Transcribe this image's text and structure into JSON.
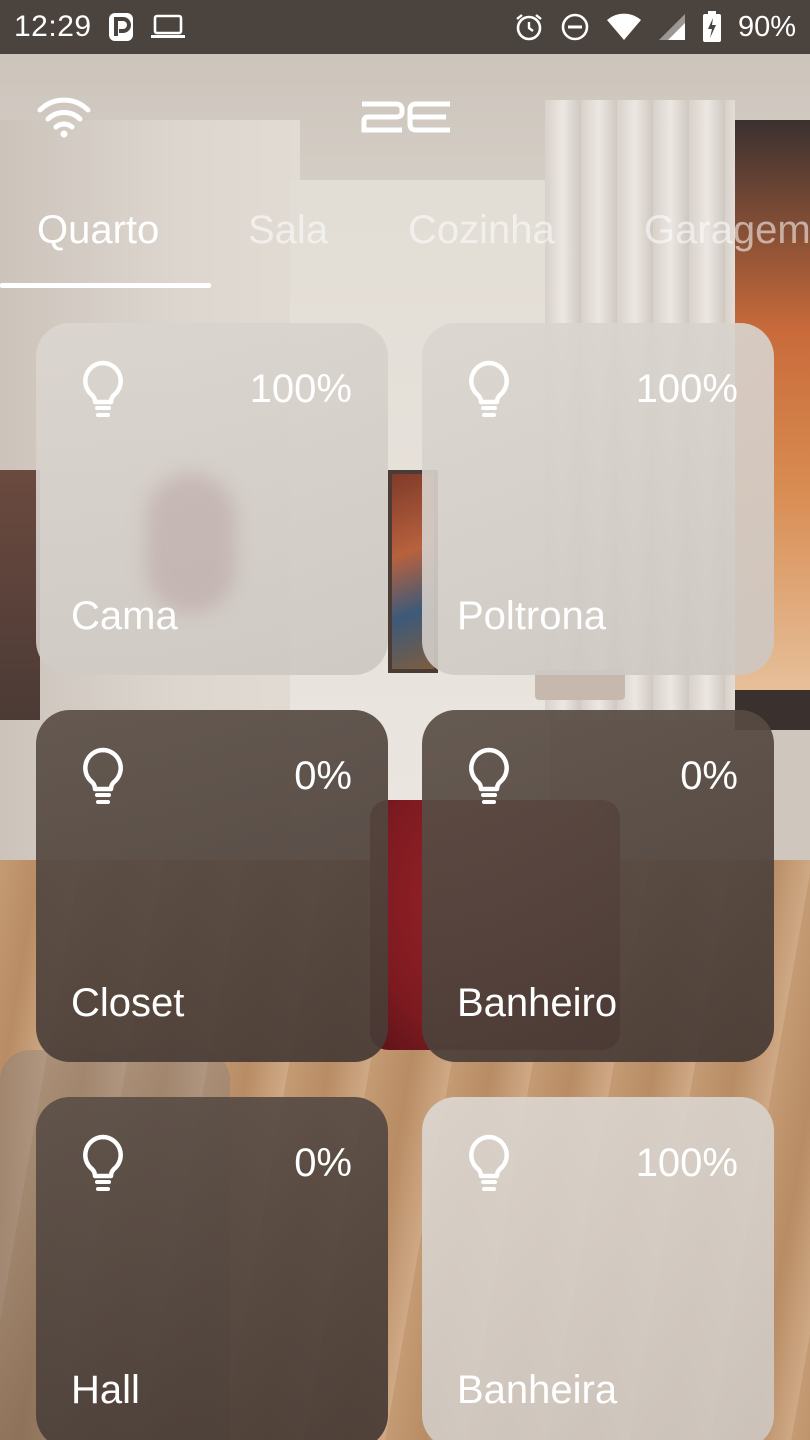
{
  "status_bar": {
    "time": "12:29",
    "left_icons": [
      "parking-app-icon",
      "laptop-icon"
    ],
    "right_icons": [
      "alarm-icon",
      "do-not-disturb-icon",
      "wifi-signal-icon",
      "cell-signal-icon",
      "battery-charging-icon"
    ],
    "battery": "90%"
  },
  "header": {
    "wifi_icon": "wifi-icon",
    "logo_text": "2E"
  },
  "tabs": [
    {
      "label": "Quarto",
      "active": true
    },
    {
      "label": "Sala",
      "active": false
    },
    {
      "label": "Cozinha",
      "active": false
    },
    {
      "label": "Garagem",
      "active": false
    }
  ],
  "tiles": [
    {
      "name": "Cama",
      "percent": "100%",
      "state": "on",
      "icon": "lightbulb-icon"
    },
    {
      "name": "Poltrona",
      "percent": "100%",
      "state": "on",
      "icon": "lightbulb-icon"
    },
    {
      "name": "Closet",
      "percent": "0%",
      "state": "off",
      "icon": "lightbulb-icon"
    },
    {
      "name": "Banheiro",
      "percent": "0%",
      "state": "off",
      "icon": "lightbulb-icon"
    },
    {
      "name": "Hall",
      "percent": "0%",
      "state": "off",
      "icon": "lightbulb-icon"
    },
    {
      "name": "Banheira",
      "percent": "100%",
      "state": "on",
      "icon": "lightbulb-icon"
    }
  ],
  "colors": {
    "status_bar_bg": "#4a433e",
    "tile_on": "#d8d2cc",
    "tile_off": "#5a4e47",
    "text": "#ffffff"
  }
}
